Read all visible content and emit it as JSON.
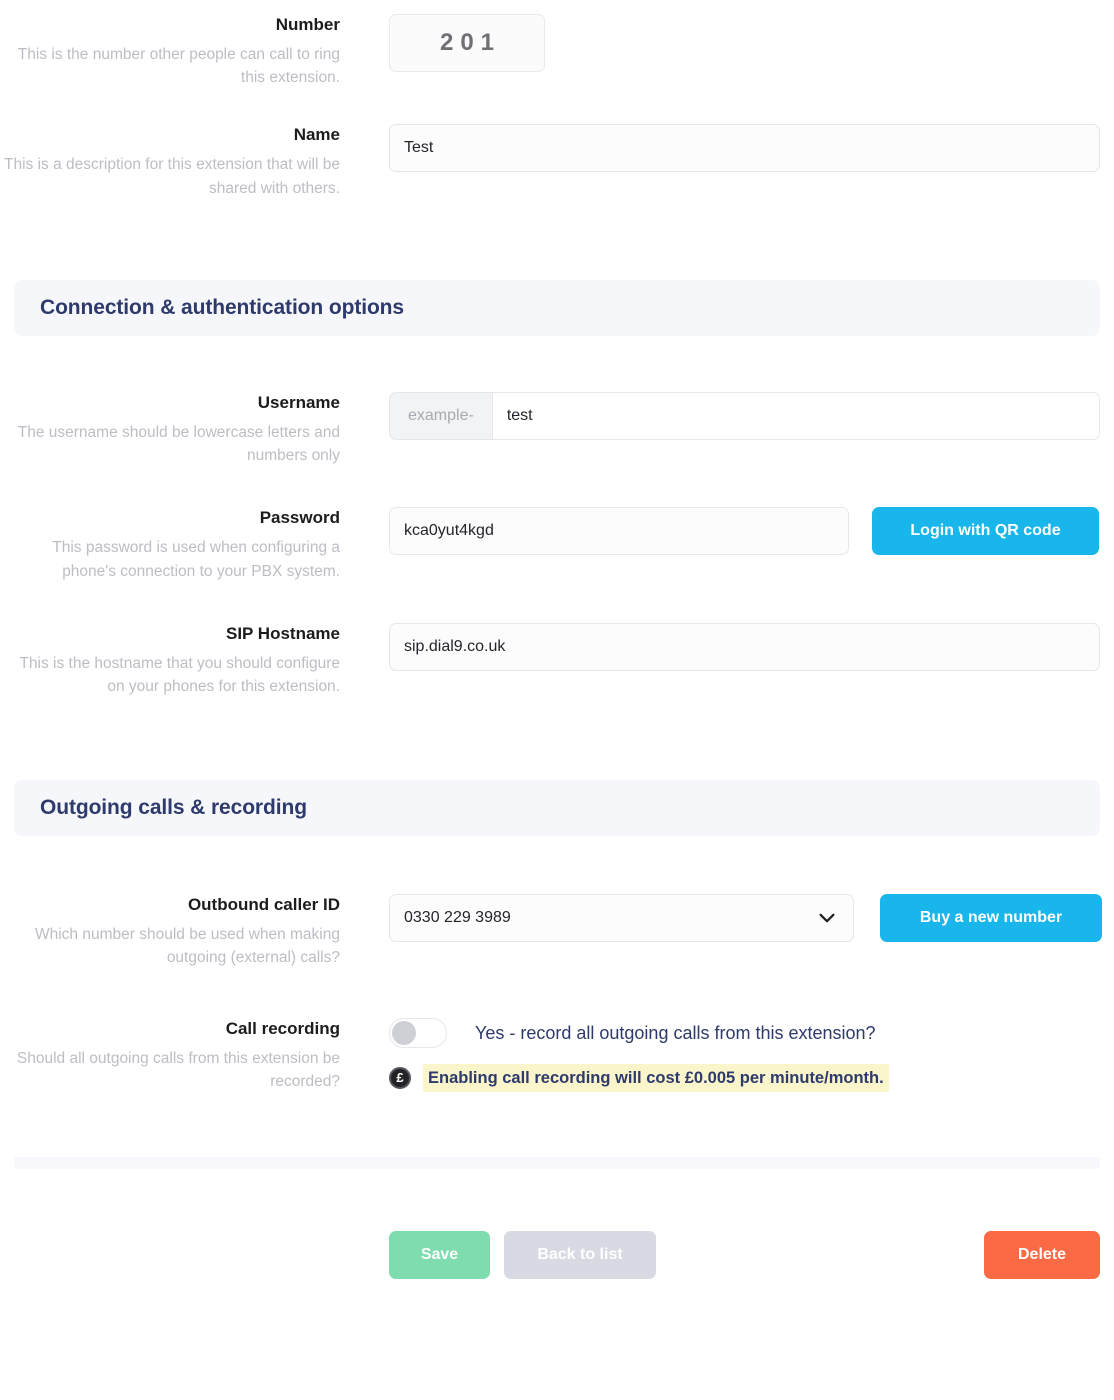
{
  "fields": {
    "number": {
      "label": "Number",
      "help": "This is the number other people can call to ring this extension.",
      "value": "201"
    },
    "name": {
      "label": "Name",
      "help": "This is a description for this extension that will be shared with others.",
      "value": "Test",
      "placeholder": ""
    },
    "username": {
      "label": "Username",
      "help": "The username should be lowercase letters and numbers only",
      "prefix": "example-",
      "value": "test",
      "placeholder": ""
    },
    "password": {
      "label": "Password",
      "help": "This password is used when configuring a phone's connection to your PBX system.",
      "value": "kca0yut4kgd",
      "placeholder": "",
      "action_label": "Login with QR code"
    },
    "sip_hostname": {
      "label": "SIP Hostname",
      "help": "This is the hostname that you should configure on your phones for this extension.",
      "value": "sip.dial9.co.uk",
      "placeholder": ""
    },
    "outbound_caller_id": {
      "label": "Outbound caller ID",
      "help": "Which number should be used when making outgoing (external) calls?",
      "value": "0330 229 3989",
      "action_label": "Buy a new number"
    },
    "call_recording": {
      "label": "Call recording",
      "help": "Should all outgoing calls from this extension be recorded?",
      "toggle_label": "Yes - record all outgoing calls from this extension?",
      "toggle_state": "off",
      "notice_icon": "£",
      "notice": "Enabling call recording will cost £0.005 per minute/month."
    }
  },
  "sections": {
    "connection": "Connection & authentication options",
    "outgoing": "Outgoing calls & recording"
  },
  "footer": {
    "save": "Save",
    "back": "Back to list",
    "delete": "Delete"
  },
  "colors": {
    "accent_blue": "#18b6eb",
    "save_green": "#7fdcae",
    "back_grey": "#d7d9e3",
    "delete_red": "#fa6a45",
    "section_title": "#2e3a6b",
    "notice_highlight": "#faf5cb"
  }
}
